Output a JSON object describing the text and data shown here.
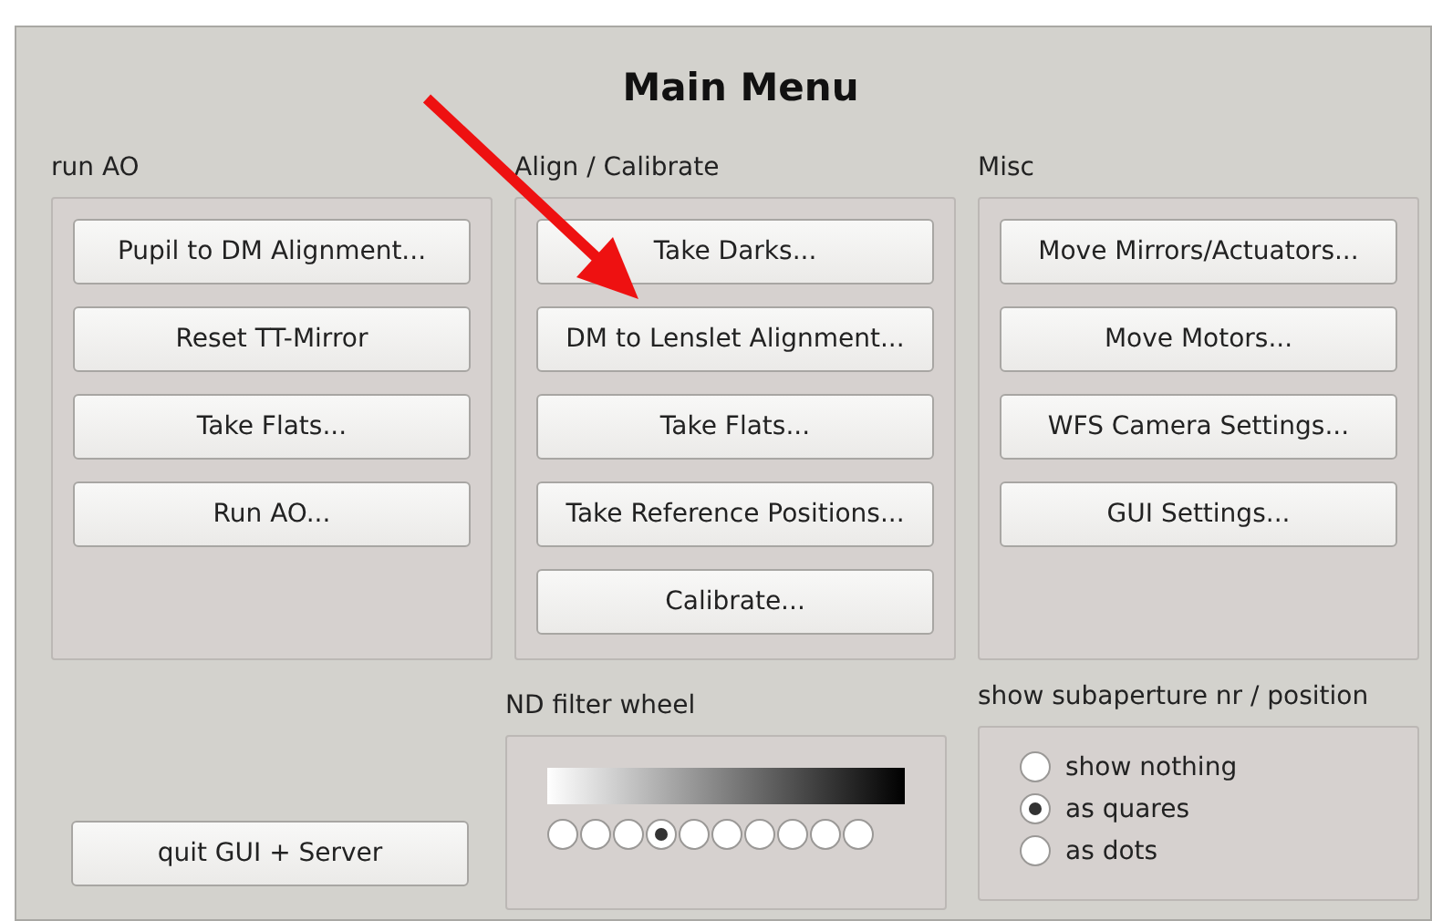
{
  "window": {
    "title": "Main Menu"
  },
  "groups": [
    {
      "label": "run AO",
      "buttons": [
        "Pupil to DM Alignment...",
        "Reset TT-Mirror",
        "Take Flats...",
        "Run AO..."
      ]
    },
    {
      "label": "Align / Calibrate",
      "buttons": [
        "Take Darks...",
        "DM to Lenslet Alignment...",
        "Take Flats...",
        "Take Reference Positions...",
        "Calibrate..."
      ]
    },
    {
      "label": "Misc",
      "buttons": [
        "Move Mirrors/Actuators...",
        "Move Motors...",
        "WFS Camera Settings...",
        "GUI Settings..."
      ]
    }
  ],
  "quit_button": "quit GUI + Server",
  "nd_filter": {
    "label": "ND filter wheel",
    "positions": [
      {
        "selected": false
      },
      {
        "selected": false
      },
      {
        "selected": false
      },
      {
        "selected": true
      },
      {
        "selected": false
      },
      {
        "selected": false
      },
      {
        "selected": false
      },
      {
        "selected": false
      },
      {
        "selected": false
      },
      {
        "selected": false
      }
    ]
  },
  "subaperture": {
    "label": "show subaperture nr / position",
    "options": [
      {
        "label": "show nothing",
        "selected": false
      },
      {
        "label": "as quares",
        "selected": true
      },
      {
        "label": "as dots",
        "selected": false
      }
    ]
  }
}
